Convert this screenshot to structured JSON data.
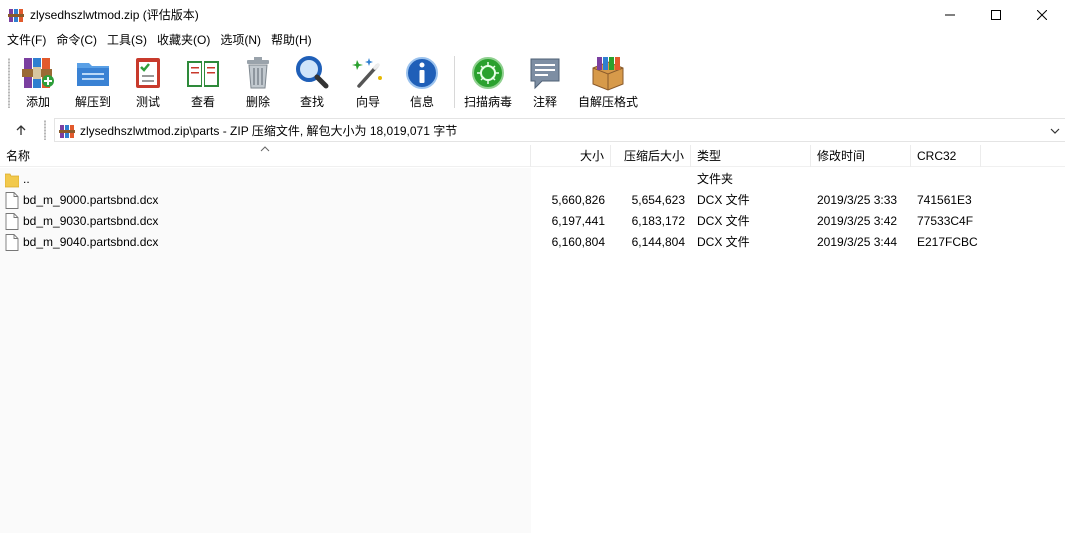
{
  "window": {
    "title": "zlysedhszlwtmod.zip (评估版本)",
    "icon": "winrar-app-icon"
  },
  "menu": [
    "文件(F)",
    "命令(C)",
    "工具(S)",
    "收藏夹(O)",
    "选项(N)",
    "帮助(H)"
  ],
  "toolbar": {
    "add": "添加",
    "extract": "解压到",
    "test": "测试",
    "view": "查看",
    "delete": "删除",
    "find": "查找",
    "wizard": "向导",
    "info": "信息",
    "virusscan": "扫描病毒",
    "comment": "注释",
    "sfx": "自解压格式"
  },
  "address": {
    "path": "zlysedhszlwtmod.zip\\parts - ZIP 压缩文件, 解包大小为 18,019,071 字节"
  },
  "columns": {
    "name": "名称",
    "size": "大小",
    "packed": "压缩后大小",
    "type": "类型",
    "modified": "修改时间",
    "crc": "CRC32"
  },
  "files": [
    {
      "name": "..",
      "size": "",
      "packed": "",
      "type": "文件夹",
      "modified": "",
      "crc": "",
      "icon": "folder-icon"
    },
    {
      "name": "bd_m_9000.partsbnd.dcx",
      "size": "5,660,826",
      "packed": "5,654,623",
      "type": "DCX 文件",
      "modified": "2019/3/25 3:33",
      "crc": "741561E3",
      "icon": "file-icon"
    },
    {
      "name": "bd_m_9030.partsbnd.dcx",
      "size": "6,197,441",
      "packed": "6,183,172",
      "type": "DCX 文件",
      "modified": "2019/3/25 3:42",
      "crc": "77533C4F",
      "icon": "file-icon"
    },
    {
      "name": "bd_m_9040.partsbnd.dcx",
      "size": "6,160,804",
      "packed": "6,144,804",
      "type": "DCX 文件",
      "modified": "2019/3/25 3:44",
      "crc": "E217FCBC",
      "icon": "file-icon"
    }
  ],
  "colors": {
    "folder": "#f2c94c",
    "scan_green": "#2aa12e",
    "info_blue": "#1f5fb8",
    "books_red": "#c83a2c"
  }
}
